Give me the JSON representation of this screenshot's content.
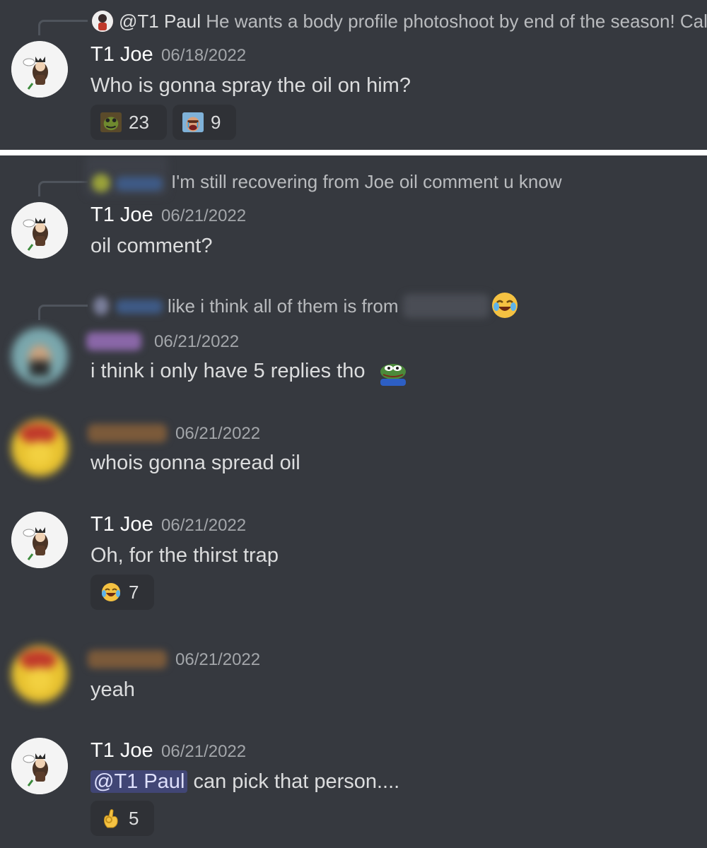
{
  "top_message": {
    "reply_author": "@T1 Paul",
    "reply_text": "He wants a body profile photoshoot by end of the season!  Cal",
    "author": "T1 Joe",
    "timestamp": "06/18/2022",
    "text": "Who is gonna spray the oil on him?",
    "reactions": [
      {
        "icon": "frog-emoji-icon",
        "count": "23"
      },
      {
        "icon": "crying-man-emoji-icon",
        "count": "9"
      }
    ]
  },
  "messages": [
    {
      "reply_text": "I'm still recovering from Joe oil comment u know",
      "author": "T1 Joe",
      "timestamp": "06/21/2022",
      "text": "oil comment?"
    },
    {
      "reply_text": "like i think all of them is from",
      "timestamp": "06/21/2022",
      "text": "i think i only have 5 replies tho"
    },
    {
      "timestamp": "06/21/2022",
      "text": "whois gonna spread oil"
    },
    {
      "author": "T1 Joe",
      "timestamp": "06/21/2022",
      "text": "Oh, for the thirst trap",
      "reactions": [
        {
          "icon": "joy-emoji-icon",
          "count": "7"
        }
      ]
    },
    {
      "timestamp": "06/21/2022",
      "text": "yeah"
    },
    {
      "author": "T1 Joe",
      "timestamp": "06/21/2022",
      "mention": "@T1 Paul",
      "text": " can pick that person....",
      "reactions": [
        {
          "icon": "ok-hand-emoji-icon",
          "count": "5"
        }
      ]
    }
  ],
  "colors": {
    "background": "#36393f",
    "reaction_bg": "#2f3136",
    "mention_bg": "#414675"
  }
}
